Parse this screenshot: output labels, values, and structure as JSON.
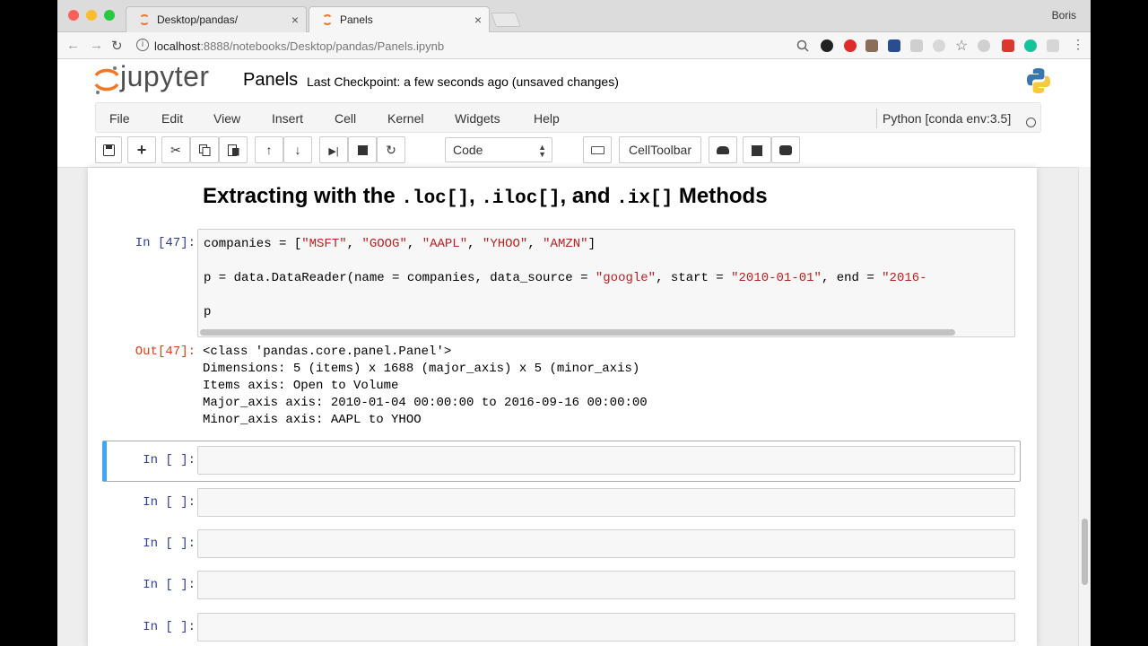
{
  "browser": {
    "tabs": [
      {
        "label": "Desktop/pandas/",
        "close": "×"
      },
      {
        "label": "Panels",
        "close": "×"
      }
    ],
    "profile": "Boris",
    "url_host": "localhost",
    "url_path": ":8888/notebooks/Desktop/pandas/Panels.ipynb",
    "nav": {
      "back": "←",
      "forward": "→",
      "reload": "↻"
    }
  },
  "jupyter": {
    "logo_text": "jupyter",
    "notebook_title": "Panels",
    "checkpoint": "Last Checkpoint: a few seconds ago (unsaved changes)",
    "menu": [
      "File",
      "Edit",
      "View",
      "Insert",
      "Cell",
      "Kernel",
      "Widgets",
      "Help"
    ],
    "kernel": "Python [conda env:3.5]",
    "cell_type": "Code",
    "celltoolbar_label": "CellToolbar"
  },
  "notebook": {
    "heading_parts": {
      "p1": "Extracting with the ",
      "c1": ".loc[]",
      "p2": ", ",
      "c2": ".iloc[]",
      "p3": ", and ",
      "c3": ".ix[]",
      "p4": " Methods"
    },
    "cell47": {
      "in_prompt": "In [47]:",
      "out_prompt": "Out[47]:",
      "line1_prefix": "companies = [",
      "line1_strings": [
        "\"MSFT\"",
        "\"GOOG\"",
        "\"AAPL\"",
        "\"YHOO\"",
        "\"AMZN\""
      ],
      "line2_a": "p = data.DataReader(name = companies, data_source = ",
      "line2_s1": "\"google\"",
      "line2_b": ", start = ",
      "line2_s2": "\"2010-01-01\"",
      "line2_c": ", end = ",
      "line2_s3": "\"2016-",
      "line3": "p",
      "output": [
        "<class 'pandas.core.panel.Panel'>",
        "Dimensions: 5 (items) x 1688 (major_axis) x 5 (minor_axis)",
        "Items axis: Open to Volume",
        "Major_axis axis: 2010-01-04 00:00:00 to 2016-09-16 00:00:00",
        "Minor_axis axis: AAPL to YHOO"
      ]
    },
    "empty_prompt": "In [ ]:"
  }
}
